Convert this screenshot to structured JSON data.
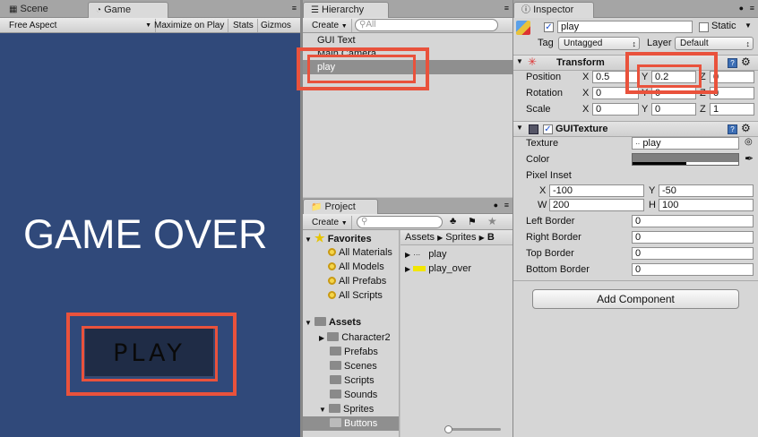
{
  "scene_panel": {
    "tabs": [
      {
        "label": "Scene"
      },
      {
        "label": "Game"
      }
    ],
    "toolbar": {
      "aspect": "Free Aspect",
      "maximize": "Maximize on Play",
      "stats": "Stats",
      "gizmos": "Gizmos"
    },
    "game_over_text": "GAME OVER",
    "play_button_text": "PLAY",
    "background_color": "#30497a"
  },
  "hierarchy": {
    "tab_label": "Hierarchy",
    "create_label": "Create",
    "search_placeholder": "All",
    "items": [
      "GUI Text",
      "Main Camera",
      "play"
    ],
    "selected": "play"
  },
  "project": {
    "tab_label": "Project",
    "create_label": "Create",
    "favorites_label": "Favorites",
    "favorites": [
      "All Materials",
      "All Models",
      "All Prefabs",
      "All Scripts"
    ],
    "assets_label": "Assets",
    "assets": [
      "Character2",
      "Prefabs",
      "Scenes",
      "Scripts",
      "Sounds",
      "Sprites",
      "Buttons"
    ],
    "breadcrumb": [
      "Assets",
      "Sprites",
      "B"
    ],
    "files": [
      "play",
      "play_over"
    ]
  },
  "inspector": {
    "tab_label": "Inspector",
    "object_name": "play",
    "static_label": "Static",
    "tag_label": "Tag",
    "tag_value": "Untagged",
    "layer_label": "Layer",
    "layer_value": "Default",
    "transform": {
      "title": "Transform",
      "position_label": "Position",
      "pos_x": "0.5",
      "pos_y": "0.2",
      "pos_z": "0",
      "rotation_label": "Rotation",
      "rot_x": "0",
      "rot_y": "0",
      "rot_z": "0",
      "scale_label": "Scale",
      "scale_x": "0",
      "scale_y": "0",
      "scale_z": "1"
    },
    "gui_texture": {
      "title": "GUITexture",
      "texture_label": "Texture",
      "texture_value": "play",
      "color_label": "Color",
      "pixel_inset_label": "Pixel Inset",
      "x": "-100",
      "y": "-50",
      "w": "200",
      "h": "100",
      "left_border_label": "Left Border",
      "left_border": "0",
      "right_border_label": "Right Border",
      "right_border": "0",
      "top_border_label": "Top Border",
      "top_border": "0",
      "bottom_border_label": "Bottom Border",
      "bottom_border": "0"
    },
    "add_component": "Add Component",
    "axis": {
      "x": "X",
      "y": "Y",
      "z": "Z",
      "w": "W",
      "h": "H"
    }
  },
  "colors": {
    "highlight_red": "#e9523c",
    "selection_gray": "#8f8f8f"
  }
}
